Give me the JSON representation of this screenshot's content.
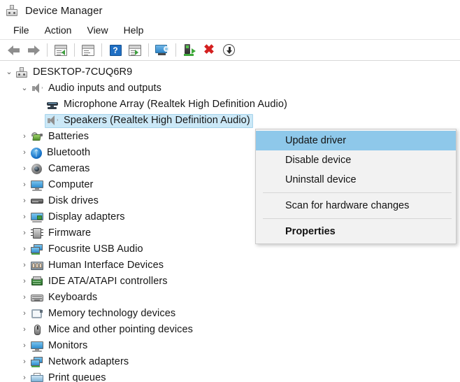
{
  "window": {
    "title": "Device Manager",
    "icon": "device-manager-icon"
  },
  "menubar": {
    "items": [
      {
        "label": "File"
      },
      {
        "label": "Action"
      },
      {
        "label": "View"
      },
      {
        "label": "Help"
      }
    ]
  },
  "toolbar": {
    "buttons": [
      {
        "icon": "back-arrow-icon"
      },
      {
        "icon": "forward-arrow-icon"
      },
      {
        "icon": "show-hide-console-tree-icon"
      },
      {
        "icon": "properties-icon"
      },
      {
        "icon": "help-icon"
      },
      {
        "icon": "show-hide-action-pane-icon"
      },
      {
        "icon": "scan-for-hardware-changes-icon"
      },
      {
        "icon": "update-driver-icon"
      },
      {
        "icon": "uninstall-device-icon"
      },
      {
        "icon": "disable-device-icon"
      }
    ]
  },
  "tree": {
    "nodes": [
      {
        "label": "DESKTOP-7CUQ6R9",
        "level": 0,
        "twisty": "expanded",
        "icon": "computer-root-icon",
        "selected": false
      },
      {
        "label": "Audio inputs and outputs",
        "level": 1,
        "twisty": "expanded",
        "icon": "speaker-icon",
        "selected": false
      },
      {
        "label": "Microphone Array (Realtek High Definition Audio)",
        "level": 2,
        "twisty": "none",
        "icon": "microphone-icon",
        "selected": false
      },
      {
        "label": "Speakers (Realtek High Definition Audio)",
        "level": 2,
        "twisty": "none",
        "icon": "speaker-icon",
        "selected": true
      },
      {
        "label": "Batteries",
        "level": 1,
        "twisty": "collapsed",
        "icon": "battery-icon",
        "selected": false
      },
      {
        "label": "Bluetooth",
        "level": 1,
        "twisty": "collapsed",
        "icon": "bluetooth-icon",
        "selected": false
      },
      {
        "label": "Cameras",
        "level": 1,
        "twisty": "collapsed",
        "icon": "camera-icon",
        "selected": false
      },
      {
        "label": "Computer",
        "level": 1,
        "twisty": "collapsed",
        "icon": "monitor-icon",
        "selected": false
      },
      {
        "label": "Disk drives",
        "level": 1,
        "twisty": "collapsed",
        "icon": "disk-drive-icon",
        "selected": false
      },
      {
        "label": "Display adapters",
        "level": 1,
        "twisty": "collapsed",
        "icon": "display-adapter-icon",
        "selected": false
      },
      {
        "label": "Firmware",
        "level": 1,
        "twisty": "collapsed",
        "icon": "firmware-chip-icon",
        "selected": false
      },
      {
        "label": "Focusrite USB Audio",
        "level": 1,
        "twisty": "collapsed",
        "icon": "network-dual-monitor-icon",
        "selected": false
      },
      {
        "label": "Human Interface Devices",
        "level": 1,
        "twisty": "collapsed",
        "icon": "human-interface-device-icon",
        "selected": false
      },
      {
        "label": "IDE ATA/ATAPI controllers",
        "level": 1,
        "twisty": "collapsed",
        "icon": "ide-controller-icon",
        "selected": false
      },
      {
        "label": "Keyboards",
        "level": 1,
        "twisty": "collapsed",
        "icon": "keyboard-icon",
        "selected": false
      },
      {
        "label": "Memory technology devices",
        "level": 1,
        "twisty": "collapsed",
        "icon": "memory-device-icon",
        "selected": false
      },
      {
        "label": "Mice and other pointing devices",
        "level": 1,
        "twisty": "collapsed",
        "icon": "mouse-icon",
        "selected": false
      },
      {
        "label": "Monitors",
        "level": 1,
        "twisty": "collapsed",
        "icon": "monitor-icon",
        "selected": false
      },
      {
        "label": "Network adapters",
        "level": 1,
        "twisty": "collapsed",
        "icon": "network-dual-monitor-icon",
        "selected": false
      },
      {
        "label": "Print queues",
        "level": 1,
        "twisty": "collapsed",
        "icon": "print-queue-icon",
        "selected": false
      }
    ],
    "twisty_glyphs": {
      "expanded": "⌄",
      "collapsed": "›",
      "none": ""
    }
  },
  "context_menu": {
    "items": [
      {
        "label": "Update driver",
        "highlighted": true,
        "bold": false,
        "separator_after": false
      },
      {
        "label": "Disable device",
        "highlighted": false,
        "bold": false,
        "separator_after": false
      },
      {
        "label": "Uninstall device",
        "highlighted": false,
        "bold": false,
        "separator_after": true
      },
      {
        "label": "Scan for hardware changes",
        "highlighted": false,
        "bold": false,
        "separator_after": true
      },
      {
        "label": "Properties",
        "highlighted": false,
        "bold": true,
        "separator_after": false
      }
    ]
  },
  "colors": {
    "selection_fill": "#cbe8f7",
    "selection_border": "#a7d4ec",
    "menu_highlight": "#8ec8ea",
    "menu_background": "#f2f2f2",
    "accent_blue": "#1f6fc4",
    "danger_red": "#d42020"
  }
}
